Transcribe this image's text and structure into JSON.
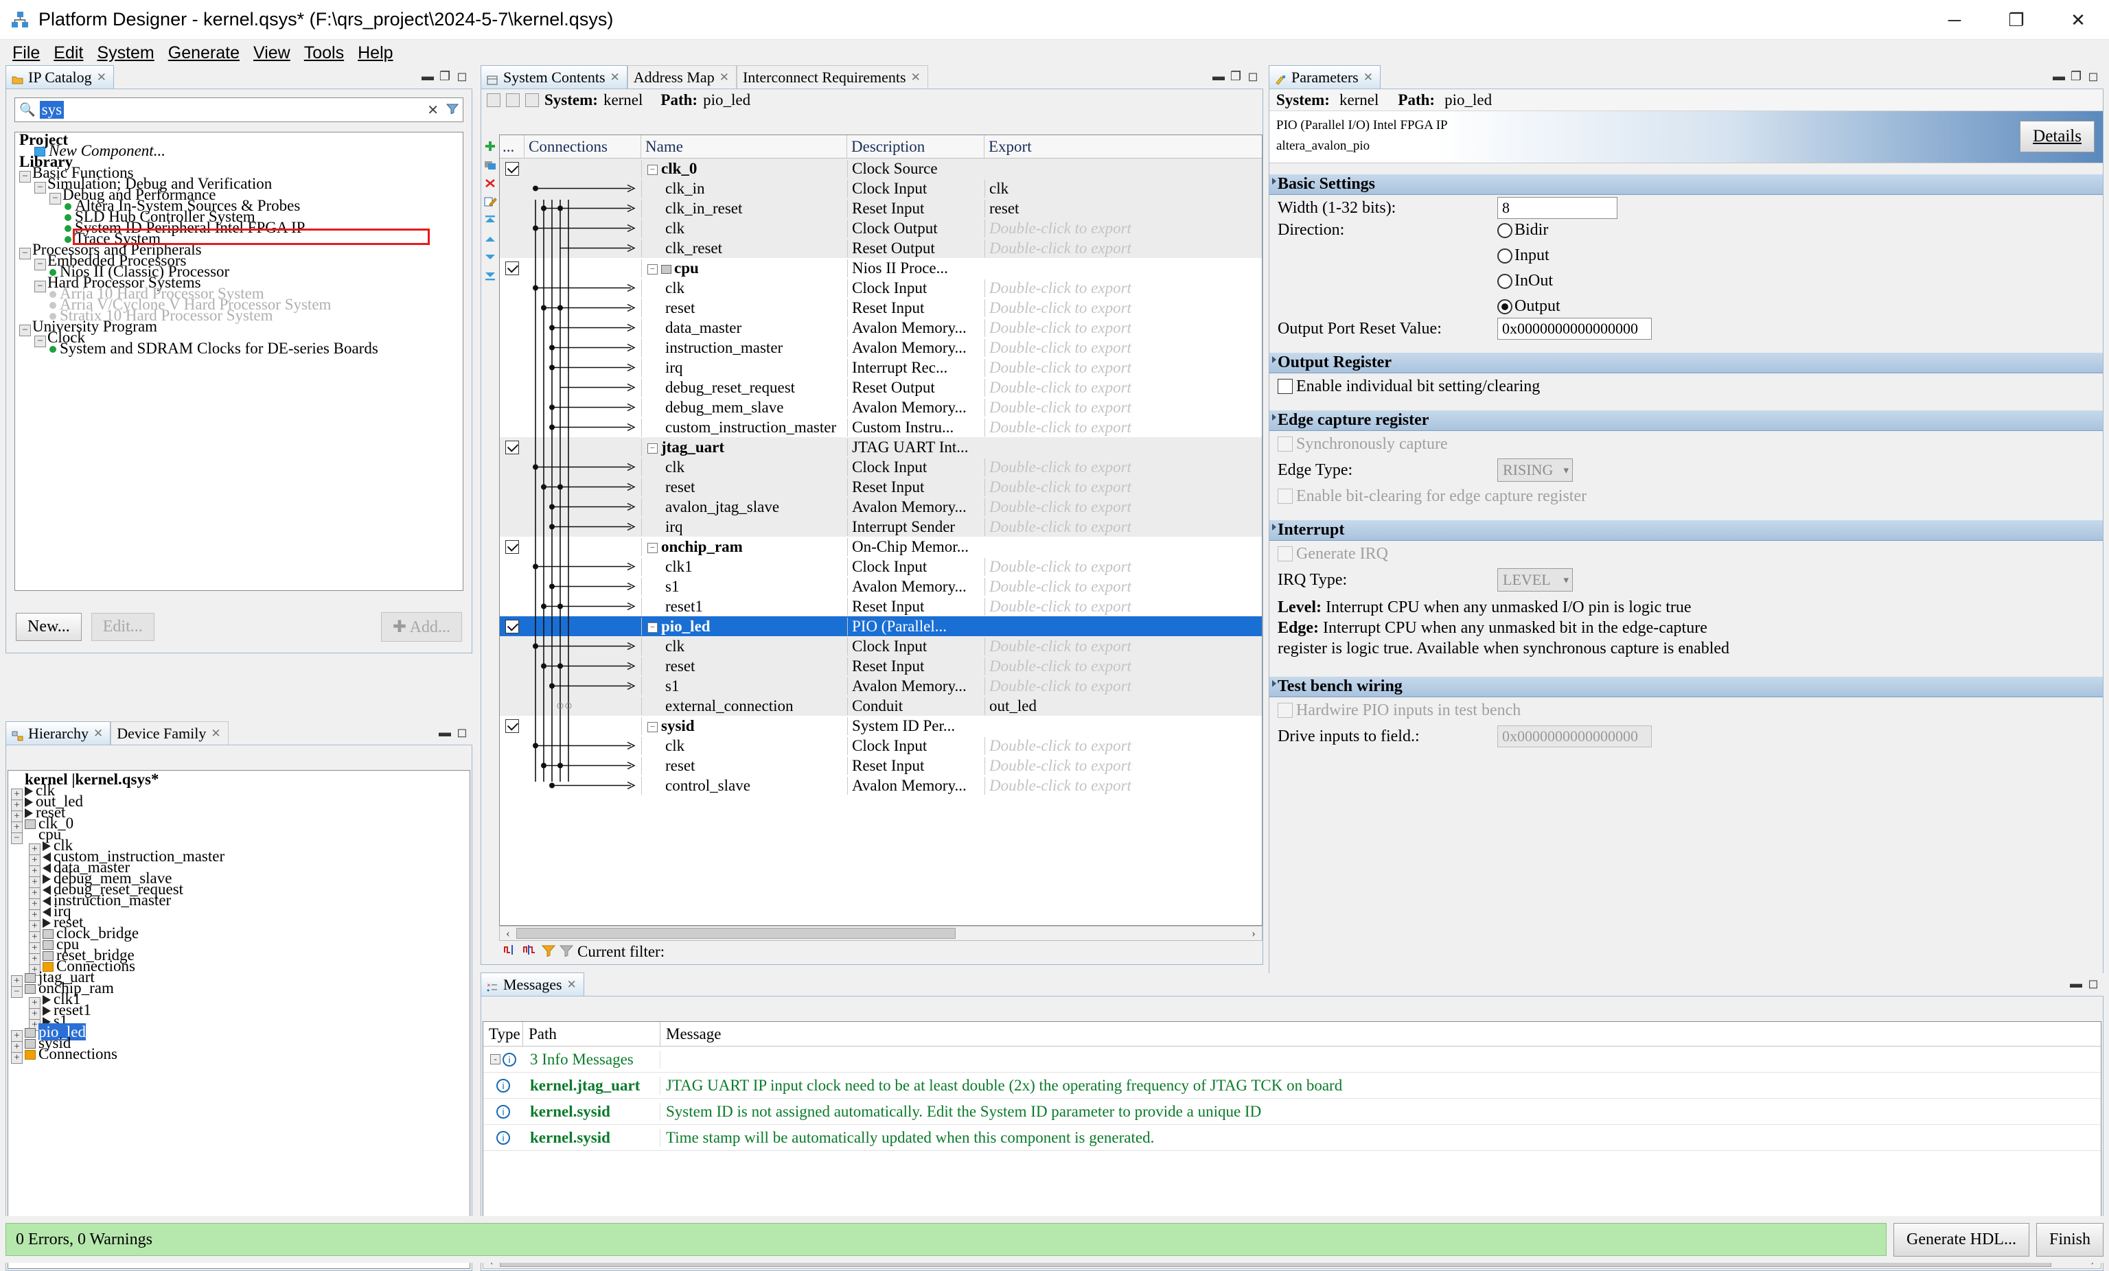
{
  "window": {
    "title": "Platform Designer - kernel.qsys* (F:\\qrs_project\\2024-5-7\\kernel.qsys)",
    "app_icon": "platform-designer-icon",
    "minimize": "─",
    "maximize": "❐",
    "close": "✕"
  },
  "menubar": {
    "items": [
      "File",
      "Edit",
      "System",
      "Generate",
      "View",
      "Tools",
      "Help"
    ]
  },
  "ip_catalog": {
    "tab_label": "IP Catalog",
    "tab_close": "✕",
    "search": {
      "value": "sys",
      "placeholder": "",
      "icon": "search-icon",
      "clear": "✕",
      "filter_icon": "funnel-icon"
    },
    "tree": [
      {
        "label": "Project",
        "indent": 0,
        "style": "bold",
        "marker": "none"
      },
      {
        "label": "New Component...",
        "indent": 1,
        "style": "italic",
        "marker": "file"
      },
      {
        "label": "Library",
        "indent": 0,
        "style": "bold",
        "marker": "none"
      },
      {
        "label": "Basic Functions",
        "indent": 0,
        "style": "plain",
        "marker": "minus"
      },
      {
        "label": "Simulation; Debug and Verification",
        "indent": 1,
        "style": "plain",
        "marker": "minus"
      },
      {
        "label": "Debug and Performance",
        "indent": 2,
        "style": "plain",
        "marker": "minus"
      },
      {
        "label": "Altera In-System Sources & Probes",
        "indent": 3,
        "style": "plain",
        "marker": "bullet"
      },
      {
        "label": "SLD Hub Controller System",
        "indent": 3,
        "style": "plain",
        "marker": "bullet"
      },
      {
        "label": "System ID Peripheral Intel FPGA IP",
        "indent": 3,
        "style": "plain",
        "marker": "bullet"
      },
      {
        "label": "Trace System",
        "indent": 3,
        "style": "plain",
        "marker": "bullet"
      },
      {
        "label": "Processors and Peripherals",
        "indent": 0,
        "style": "plain",
        "marker": "minus"
      },
      {
        "label": "Embedded Processors",
        "indent": 1,
        "style": "plain",
        "marker": "minus"
      },
      {
        "label": "Nios II (Classic) Processor",
        "indent": 2,
        "style": "plain",
        "marker": "bullet"
      },
      {
        "label": "Hard Processor Systems",
        "indent": 1,
        "style": "plain",
        "marker": "minus"
      },
      {
        "label": "Arria 10 Hard Processor System",
        "indent": 2,
        "style": "dim",
        "marker": "bullet-dim"
      },
      {
        "label": "Arria V/Cyclone V Hard Processor System",
        "indent": 2,
        "style": "dim",
        "marker": "bullet-dim"
      },
      {
        "label": "Stratix 10 Hard Processor System",
        "indent": 2,
        "style": "dim",
        "marker": "bullet-dim"
      },
      {
        "label": "University Program",
        "indent": 0,
        "style": "plain",
        "marker": "minus"
      },
      {
        "label": "Clock",
        "indent": 1,
        "style": "plain",
        "marker": "minus"
      },
      {
        "label": "System and SDRAM Clocks for DE-series Boards",
        "indent": 2,
        "style": "plain",
        "marker": "bullet"
      }
    ],
    "highlight_row_index": 8,
    "buttons": {
      "new": "New...",
      "edit": "Edit...",
      "add": "Add...",
      "add_icon": "plus-icon"
    }
  },
  "hierarchy": {
    "tabs": [
      {
        "label": "Hierarchy",
        "icon": "hierarchy-icon",
        "active": true,
        "close": "✕"
      },
      {
        "label": "Device Family",
        "icon": "chip-icon",
        "active": false,
        "close": "✕"
      }
    ],
    "rows": [
      {
        "label": "kernel  |kernel.qsys*",
        "indent": 0,
        "exp": "none",
        "icon": "system",
        "bold": true
      },
      {
        "label": "clk",
        "indent": 0,
        "exp": "+",
        "icon": "port"
      },
      {
        "label": "out_led",
        "indent": 0,
        "exp": "+",
        "icon": "port"
      },
      {
        "label": "reset",
        "indent": 0,
        "exp": "+",
        "icon": "port"
      },
      {
        "label": "clk_0",
        "indent": 0,
        "exp": "+",
        "icon": "mod"
      },
      {
        "label": "cpu",
        "indent": 0,
        "exp": "-",
        "icon": "system"
      },
      {
        "label": "clk",
        "indent": 1,
        "exp": "+",
        "icon": "port"
      },
      {
        "label": "custom_instruction_master",
        "indent": 1,
        "exp": "+",
        "icon": "portl"
      },
      {
        "label": "data_master",
        "indent": 1,
        "exp": "+",
        "icon": "portl"
      },
      {
        "label": "debug_mem_slave",
        "indent": 1,
        "exp": "+",
        "icon": "port"
      },
      {
        "label": "debug_reset_request",
        "indent": 1,
        "exp": "+",
        "icon": "portl"
      },
      {
        "label": "instruction_master",
        "indent": 1,
        "exp": "+",
        "icon": "portl"
      },
      {
        "label": "irq",
        "indent": 1,
        "exp": "+",
        "icon": "portl"
      },
      {
        "label": "reset",
        "indent": 1,
        "exp": "+",
        "icon": "port"
      },
      {
        "label": "clock_bridge",
        "indent": 1,
        "exp": "+",
        "icon": "mod"
      },
      {
        "label": "cpu",
        "indent": 1,
        "exp": "+",
        "icon": "mod"
      },
      {
        "label": "reset_bridge",
        "indent": 1,
        "exp": "+",
        "icon": "mod"
      },
      {
        "label": "Connections",
        "indent": 1,
        "exp": "+",
        "icon": "folder"
      },
      {
        "label": "jtag_uart",
        "indent": 0,
        "exp": "+",
        "icon": "mod"
      },
      {
        "label": "onchip_ram",
        "indent": 0,
        "exp": "-",
        "icon": "mod"
      },
      {
        "label": "clk1",
        "indent": 1,
        "exp": "+",
        "icon": "port"
      },
      {
        "label": "reset1",
        "indent": 1,
        "exp": "+",
        "icon": "port"
      },
      {
        "label": "s1",
        "indent": 1,
        "exp": "+",
        "icon": "port"
      },
      {
        "label": "pio_led",
        "indent": 0,
        "exp": "+",
        "icon": "mod",
        "selected": true
      },
      {
        "label": "sysid",
        "indent": 0,
        "exp": "+",
        "icon": "mod"
      },
      {
        "label": "Connections",
        "indent": 0,
        "exp": "+",
        "icon": "folder"
      }
    ]
  },
  "system_contents": {
    "tabs": [
      {
        "label": "System Contents",
        "active": true,
        "close": "✕",
        "icon": "system-contents-icon"
      },
      {
        "label": "Address Map",
        "active": false,
        "close": "✕"
      },
      {
        "label": "Interconnect Requirements",
        "active": false,
        "close": "✕"
      }
    ],
    "path_bar": {
      "system_label": "System:",
      "system_value": "kernel",
      "path_label": "Path:",
      "path_value": "pio_led"
    },
    "columns": [
      "...",
      "Connections",
      "Name",
      "Description",
      "Export"
    ],
    "tools": [
      "add-icon",
      "duplicate-icon",
      "remove-icon",
      "edit-icon",
      "move-top-icon",
      "move-up-icon",
      "move-down-icon",
      "move-bottom-icon"
    ],
    "rows": [
      {
        "check": true,
        "name": "clk_0",
        "top": true,
        "desc": "Clock Source",
        "export": "",
        "exp": "-",
        "shade": "alt"
      },
      {
        "check": null,
        "name": "clk_in",
        "top": false,
        "desc": "Clock Input",
        "export": "clk",
        "shade": "alt"
      },
      {
        "check": null,
        "name": "clk_in_reset",
        "top": false,
        "desc": "Reset Input",
        "export": "reset",
        "shade": "alt"
      },
      {
        "check": null,
        "name": "clk",
        "top": false,
        "desc": "Clock Output",
        "export": "Double-click to export",
        "placeholder": true,
        "shade": "alt"
      },
      {
        "check": null,
        "name": "clk_reset",
        "top": false,
        "desc": "Reset Output",
        "export": "Double-click to export",
        "placeholder": true,
        "shade": "alt"
      },
      {
        "check": true,
        "name": "cpu",
        "top": true,
        "desc": "Nios II Proce...",
        "export": "",
        "exp": "-",
        "icon": "module-icon",
        "shade": "none"
      },
      {
        "check": null,
        "name": "clk",
        "top": false,
        "desc": "Clock Input",
        "export": "Double-click to export",
        "placeholder": true,
        "shade": "none"
      },
      {
        "check": null,
        "name": "reset",
        "top": false,
        "desc": "Reset Input",
        "export": "Double-click to export",
        "placeholder": true,
        "shade": "none"
      },
      {
        "check": null,
        "name": "data_master",
        "top": false,
        "desc": "Avalon Memory...",
        "export": "Double-click to export",
        "placeholder": true,
        "shade": "none"
      },
      {
        "check": null,
        "name": "instruction_master",
        "top": false,
        "desc": "Avalon Memory...",
        "export": "Double-click to export",
        "placeholder": true,
        "shade": "none"
      },
      {
        "check": null,
        "name": "irq",
        "top": false,
        "desc": "Interrupt Rec...",
        "export": "Double-click to export",
        "placeholder": true,
        "shade": "none"
      },
      {
        "check": null,
        "name": "debug_reset_request",
        "top": false,
        "desc": "Reset Output",
        "export": "Double-click to export",
        "placeholder": true,
        "shade": "none"
      },
      {
        "check": null,
        "name": "debug_mem_slave",
        "top": false,
        "desc": "Avalon Memory...",
        "export": "Double-click to export",
        "placeholder": true,
        "shade": "none"
      },
      {
        "check": null,
        "name": "custom_instruction_master",
        "top": false,
        "desc": "Custom Instru...",
        "export": "Double-click to export",
        "placeholder": true,
        "shade": "none"
      },
      {
        "check": true,
        "name": "jtag_uart",
        "top": true,
        "desc": "JTAG UART Int...",
        "export": "",
        "exp": "-",
        "shade": "alt"
      },
      {
        "check": null,
        "name": "clk",
        "top": false,
        "desc": "Clock Input",
        "export": "Double-click to export",
        "placeholder": true,
        "shade": "alt"
      },
      {
        "check": null,
        "name": "reset",
        "top": false,
        "desc": "Reset Input",
        "export": "Double-click to export",
        "placeholder": true,
        "shade": "alt"
      },
      {
        "check": null,
        "name": "avalon_jtag_slave",
        "top": false,
        "desc": "Avalon Memory...",
        "export": "Double-click to export",
        "placeholder": true,
        "shade": "alt"
      },
      {
        "check": null,
        "name": "irq",
        "top": false,
        "desc": "Interrupt Sender",
        "export": "Double-click to export",
        "placeholder": true,
        "shade": "alt"
      },
      {
        "check": true,
        "name": "onchip_ram",
        "top": true,
        "desc": "On-Chip Memor...",
        "export": "",
        "exp": "-",
        "shade": "none"
      },
      {
        "check": null,
        "name": "clk1",
        "top": false,
        "desc": "Clock Input",
        "export": "Double-click to export",
        "placeholder": true,
        "shade": "none"
      },
      {
        "check": null,
        "name": "s1",
        "top": false,
        "desc": "Avalon Memory...",
        "export": "Double-click to export",
        "placeholder": true,
        "shade": "none"
      },
      {
        "check": null,
        "name": "reset1",
        "top": false,
        "desc": "Reset Input",
        "export": "Double-click to export",
        "placeholder": true,
        "shade": "none"
      },
      {
        "check": true,
        "name": "pio_led",
        "top": true,
        "desc": "PIO (Parallel...",
        "export": "",
        "exp": "-",
        "selected": true,
        "shade": "sel"
      },
      {
        "check": null,
        "name": "clk",
        "top": false,
        "desc": "Clock Input",
        "export": "Double-click to export",
        "placeholder": true,
        "shade": "alt"
      },
      {
        "check": null,
        "name": "reset",
        "top": false,
        "desc": "Reset Input",
        "export": "Double-click to export",
        "placeholder": true,
        "shade": "alt"
      },
      {
        "check": null,
        "name": "s1",
        "top": false,
        "desc": "Avalon Memory...",
        "export": "Double-click to export",
        "placeholder": true,
        "shade": "alt"
      },
      {
        "check": null,
        "name": "external_connection",
        "top": false,
        "desc": "Conduit",
        "export": "out_led",
        "shade": "alt"
      },
      {
        "check": true,
        "name": "sysid",
        "top": true,
        "desc": "System ID Per...",
        "export": "",
        "exp": "-",
        "shade": "none"
      },
      {
        "check": null,
        "name": "clk",
        "top": false,
        "desc": "Clock Input",
        "export": "Double-click to export",
        "placeholder": true,
        "shade": "none"
      },
      {
        "check": null,
        "name": "reset",
        "top": false,
        "desc": "Reset Input",
        "export": "Double-click to export",
        "placeholder": true,
        "shade": "none"
      },
      {
        "check": null,
        "name": "control_slave",
        "top": false,
        "desc": "Avalon Memory...",
        "export": "Double-click to export",
        "placeholder": true,
        "shade": "none"
      }
    ],
    "filter_bar": {
      "label": "Current filter:",
      "value": "",
      "icons": [
        "show-signals-icon",
        "hide-signals-icon",
        "filter-on-icon",
        "filter-off-icon"
      ]
    }
  },
  "parameters": {
    "tab_label": "Parameters",
    "tab_close": "✕",
    "path_bar": {
      "system_label": "System:",
      "system_value": "kernel",
      "path_label": "Path:",
      "path_value": "pio_led"
    },
    "banner": {
      "line1": "PIO (Parallel I/O) Intel FPGA IP",
      "line2": "altera_avalon_pio",
      "details_button": "Details"
    },
    "sections": {
      "basic": {
        "title": "Basic Settings",
        "width_label": "Width (1-32 bits):",
        "width_value": "8",
        "direction_label": "Direction:",
        "direction_options": [
          "Bidir",
          "Input",
          "InOut",
          "Output"
        ],
        "direction_selected": "Output",
        "reset_value_label": "Output Port Reset Value:",
        "reset_value": "0x0000000000000000"
      },
      "output_register": {
        "title": "Output Register",
        "enable_bitset_label": "Enable individual bit setting/clearing",
        "enable_bitset_checked": false
      },
      "edge_capture": {
        "title": "Edge capture register",
        "sync_capture_label": "Synchronously capture",
        "sync_capture_checked": false,
        "edge_type_label": "Edge Type:",
        "edge_type_value": "RISING",
        "bit_clearing_label": "Enable bit-clearing for edge capture register",
        "bit_clearing_checked": false
      },
      "interrupt": {
        "title": "Interrupt",
        "generate_irq_label": "Generate IRQ",
        "generate_irq_checked": false,
        "irq_type_label": "IRQ Type:",
        "irq_type_value": "LEVEL",
        "help_line1_bold": "Level:",
        "help_line1": " Interrupt CPU when any unmasked I/O pin is logic true",
        "help_line2_bold": "Edge:",
        "help_line2": " Interrupt CPU when any unmasked bit in the edge-capture",
        "help_line3": "register is logic true. Available when synchronous capture is enabled"
      },
      "test_bench": {
        "title": "Test bench wiring",
        "hardwire_label": "Hardwire PIO inputs in test bench",
        "hardwire_checked": false,
        "drive_inputs_label": "Drive inputs to field.:",
        "drive_inputs_value": "0x0000000000000000"
      }
    }
  },
  "messages": {
    "tab_label": "Messages",
    "tab_close": "✕",
    "columns": [
      "Type",
      "Path",
      "Message"
    ],
    "group_row": {
      "label": "3 Info Messages",
      "expander": "-",
      "icon": "info-icon"
    },
    "rows": [
      {
        "icon": "info-icon",
        "path": "kernel.jtag_uart",
        "message": "JTAG UART IP input clock need to be at least double (2x) the operating frequency of JTAG TCK on board"
      },
      {
        "icon": "info-icon",
        "path": "kernel.sysid",
        "message": "System ID is not assigned automatically. Edit the System ID parameter to provide a unique ID"
      },
      {
        "icon": "info-icon",
        "path": "kernel.sysid",
        "message": "Time stamp will be automatically updated when this component is generated."
      }
    ]
  },
  "statusbar": {
    "message": "0 Errors, 0 Warnings",
    "generate_button": "Generate HDL...",
    "finish_button": "Finish"
  },
  "colors": {
    "selection_blue": "#1a6fd4",
    "status_green": "#b6e8ad",
    "message_green": "#0a7a2a",
    "highlight_red": "#e81a1a",
    "section_header_blue": "#a9c3de"
  }
}
